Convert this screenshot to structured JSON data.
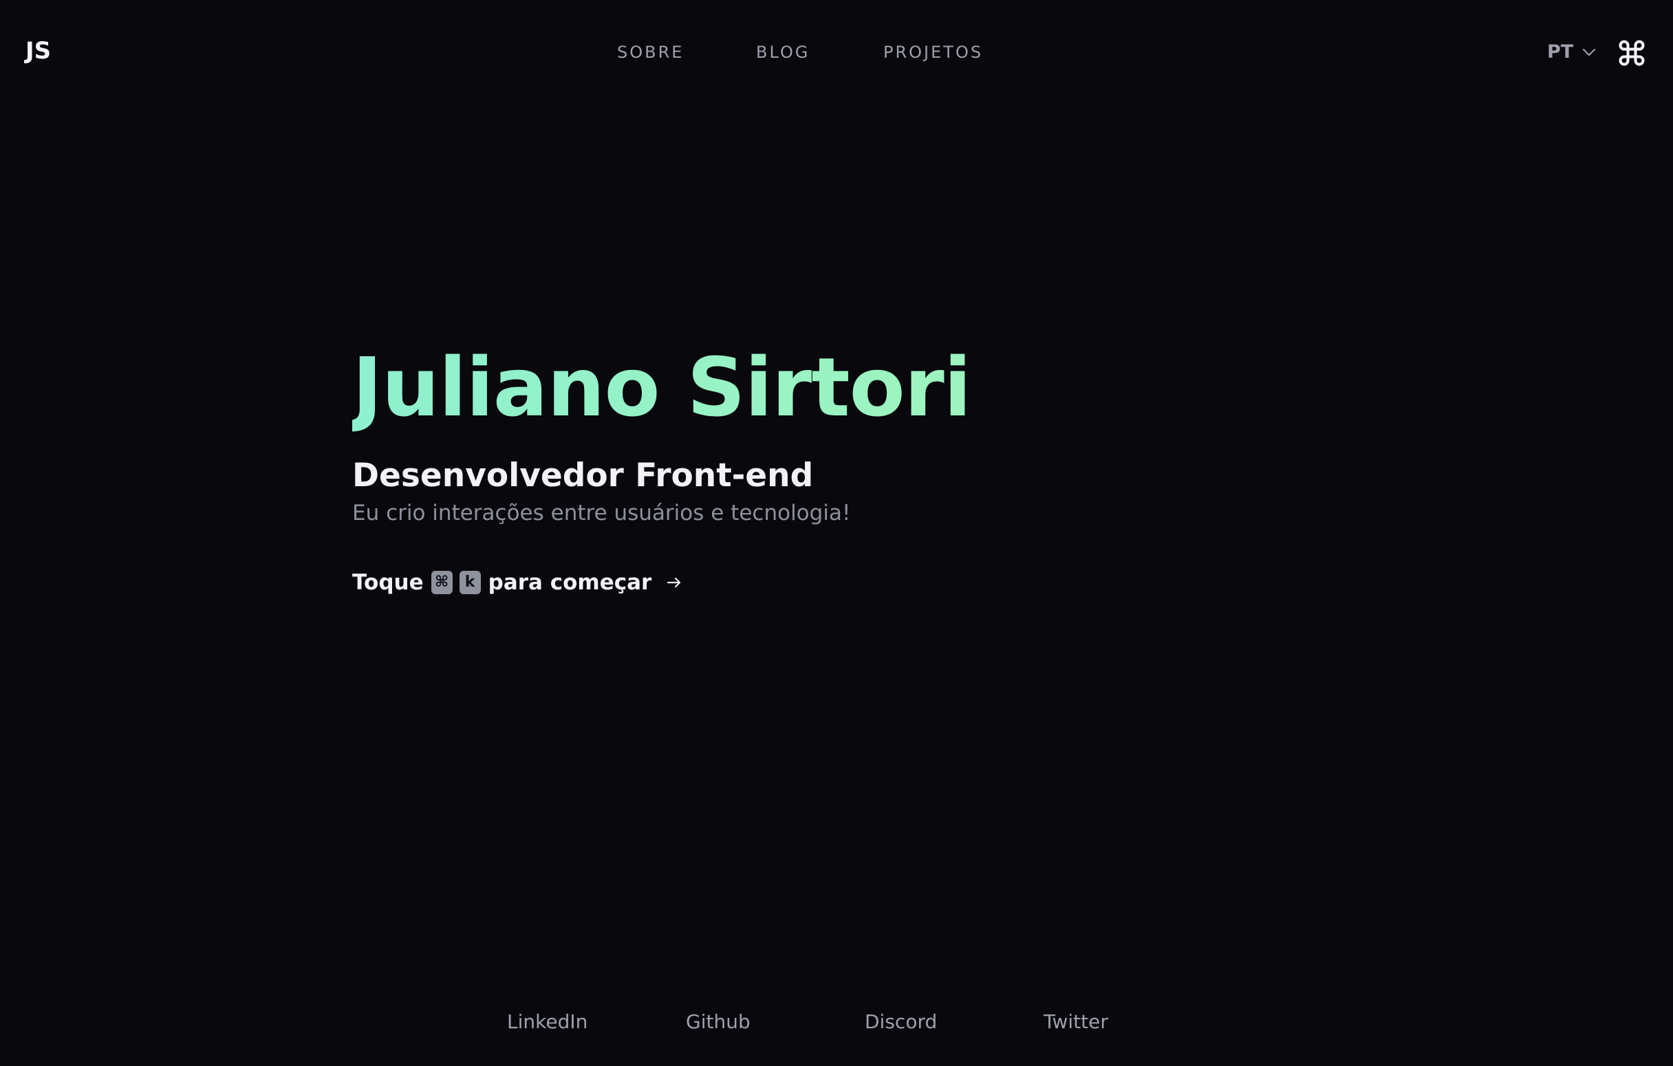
{
  "header": {
    "logo": "JS",
    "nav": [
      {
        "label": "SOBRE"
      },
      {
        "label": "BLOG"
      },
      {
        "label": "PROJETOS"
      }
    ],
    "language": {
      "selected": "PT",
      "icon": "chevron-down-icon"
    },
    "command_icon": "command-icon"
  },
  "hero": {
    "name": "Juliano Sirtori",
    "role": "Desenvolvedor Front-end",
    "tagline": "Eu crio interações entre usuários e tecnologia!",
    "cta": {
      "prefix": "Toque",
      "keys": [
        "⌘",
        "k"
      ],
      "suffix": "para começar",
      "icon": "arrow-right-icon"
    },
    "name_gradient": [
      "#8ef0cf",
      "#a6f7b4"
    ]
  },
  "footer": {
    "links": [
      {
        "label": "LinkedIn"
      },
      {
        "label": "Github"
      },
      {
        "label": "Discord"
      },
      {
        "label": "Twitter"
      }
    ]
  },
  "colors": {
    "background": "#08080d",
    "text_primary": "#f3f3f6",
    "text_muted": "#9ea1ab",
    "kbd_background": "#8e929d"
  }
}
